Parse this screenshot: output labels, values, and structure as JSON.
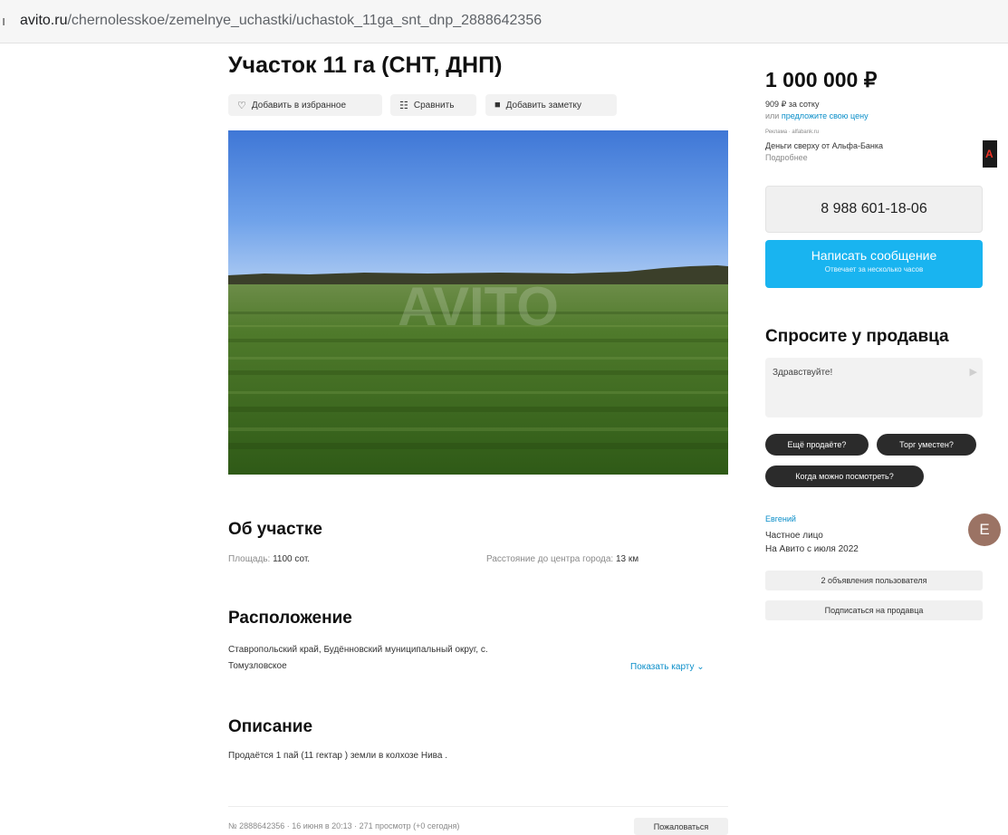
{
  "browser": {
    "url_domain": "avito.ru",
    "url_path": "/chernolesskoe/zemelnye_uchastki/uchastok_11ga_snt_dnp_2888642356"
  },
  "listing": {
    "title": "Участок 11 га (СНТ, ДНП)",
    "actions": {
      "favorite": "Добавить в избранное",
      "compare": "Сравнить",
      "note": "Добавить заметку"
    },
    "photo_watermark": "AVITO"
  },
  "about": {
    "heading": "Об участке",
    "area_label": "Площадь:",
    "area_value": "1100 сот.",
    "distance_label": "Расстояние до центра города:",
    "distance_value": "13 км"
  },
  "location": {
    "heading": "Расположение",
    "address_line1": "Ставропольский край, Будённовский муниципальный округ, с.",
    "address_line2": "Томузловское",
    "show_map": "Показать карту"
  },
  "description": {
    "heading": "Описание",
    "text": "Продаётся 1 пай (11 гектар ) земли в колхозе Нива ."
  },
  "footer": {
    "meta": "№ 2888642356 · 16 июня в 20:13 · 271 просмотр (+0 сегодня)",
    "report": "Пожаловаться"
  },
  "sidebar": {
    "price": "1 000 000 ₽",
    "price_per": "909 ₽ за сотку",
    "offer_prefix": "или",
    "offer_link": "предложите свою цену",
    "ad_label": "Реклама · alfabank.ru",
    "ad_text": "Деньги сверху от Альфа-Банка",
    "ad_more": "Подробнее",
    "ad_logo_letter": "А",
    "phone": "8 988 601-18-06",
    "message_button": "Написать сообщение",
    "message_sub": "Отвечает за несколько часов",
    "ask_title": "Спросите у продавца",
    "ask_placeholder": "Здравствуйте!",
    "chips": [
      "Ещё продаёте?",
      "Торг уместен?",
      "Когда можно посмотреть?"
    ],
    "seller": {
      "name": "Евгений",
      "type": "Частное лицо",
      "since": "На Авито с июля 2022",
      "avatar_letter": "E"
    },
    "user_ads_button": "2 объявления пользователя",
    "subscribe_button": "Подписаться на продавца"
  },
  "colors": {
    "accent": "#19b4f0",
    "link": "#0a8ec9",
    "chip_bg": "#2b2b2b",
    "avatar": "#9b7364",
    "alfa_red": "#ef3124"
  },
  "icons": {
    "favorite": "heart-icon",
    "compare": "compare-icon",
    "note": "note-icon",
    "send": "send-icon",
    "map_toggle": "chevron-down-icon"
  }
}
